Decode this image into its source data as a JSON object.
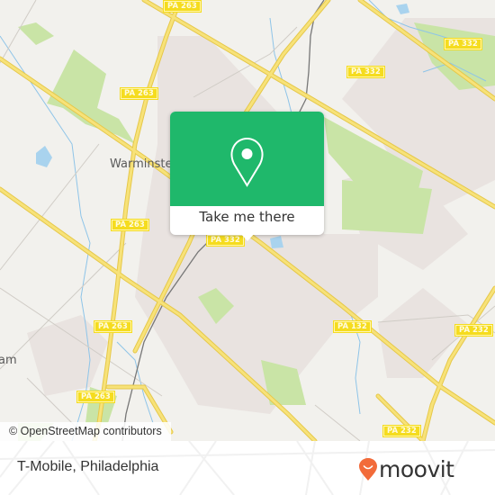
{
  "map": {
    "place_labels": [
      {
        "id": "warminster",
        "text": "Warminster"
      },
      {
        "id": "hatboro-partial",
        "text": "am"
      }
    ],
    "route_shields": [
      {
        "id": "pa263-top",
        "text": "PA 263"
      },
      {
        "id": "pa263-left-upper",
        "text": "PA 263"
      },
      {
        "id": "pa263-mid",
        "text": "PA 263"
      },
      {
        "id": "pa263-lower",
        "text": "PA 263"
      },
      {
        "id": "pa263-bottom",
        "text": "PA 263"
      },
      {
        "id": "pa332-top-right",
        "text": "PA 332"
      },
      {
        "id": "pa332-right",
        "text": "PA 332"
      },
      {
        "id": "pa332-center",
        "text": "PA 332"
      },
      {
        "id": "pa132",
        "text": "PA 132"
      },
      {
        "id": "pa232-right",
        "text": "PA 232"
      },
      {
        "id": "pa232-bottom",
        "text": "PA 232"
      }
    ],
    "attribution": "© OpenStreetMap contributors",
    "colors": {
      "background": "#f2f1ed",
      "urban": "#e9e3e0",
      "park": "#c9e4a6",
      "water": "#a9d3ee",
      "road": "#f5dc6a",
      "road_outline": "#e6c84a"
    }
  },
  "popup": {
    "action_label": "Take me there",
    "icon": "location-pin-icon",
    "accent_color": "#1fb86b"
  },
  "footer": {
    "title": "T-Mobile, Philadelphia",
    "logo_text": "moovit",
    "logo_icon": "moovit-smiley-pin-icon",
    "logo_color": "#f26b3a"
  }
}
